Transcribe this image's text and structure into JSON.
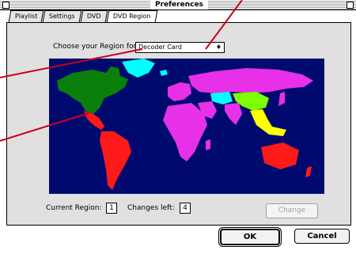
{
  "window": {
    "title": "Preferences"
  },
  "tabs": [
    {
      "label": "Playlist",
      "active": false
    },
    {
      "label": "Settings",
      "active": false
    },
    {
      "label": "DVD",
      "active": false
    },
    {
      "label": "DVD Region",
      "active": true
    }
  ],
  "region": {
    "choose_label": "Choose your Region for:",
    "selected_device": "Decoder Card"
  },
  "status": {
    "current_region_label": "Current Region:",
    "current_region_value": "1",
    "changes_left_label": "Changes left:",
    "changes_left_value": "4"
  },
  "buttons": {
    "change": "Change",
    "ok": "OK",
    "cancel": "Cancel"
  },
  "colors": {
    "ocean": "#000a6e",
    "region_1_north_america": "#0a7f0a",
    "region_2_europe_japan_middle_east": "#e830e8",
    "region_3_southeast_asia": "#ffff00",
    "region_4_latin_america_oceania": "#ff1a1a",
    "region_5_russia_africa": "#e830e8",
    "region_6_china": "#7cff00",
    "greenland_region": "#00ffff",
    "callout_lines": "#c8001e"
  }
}
